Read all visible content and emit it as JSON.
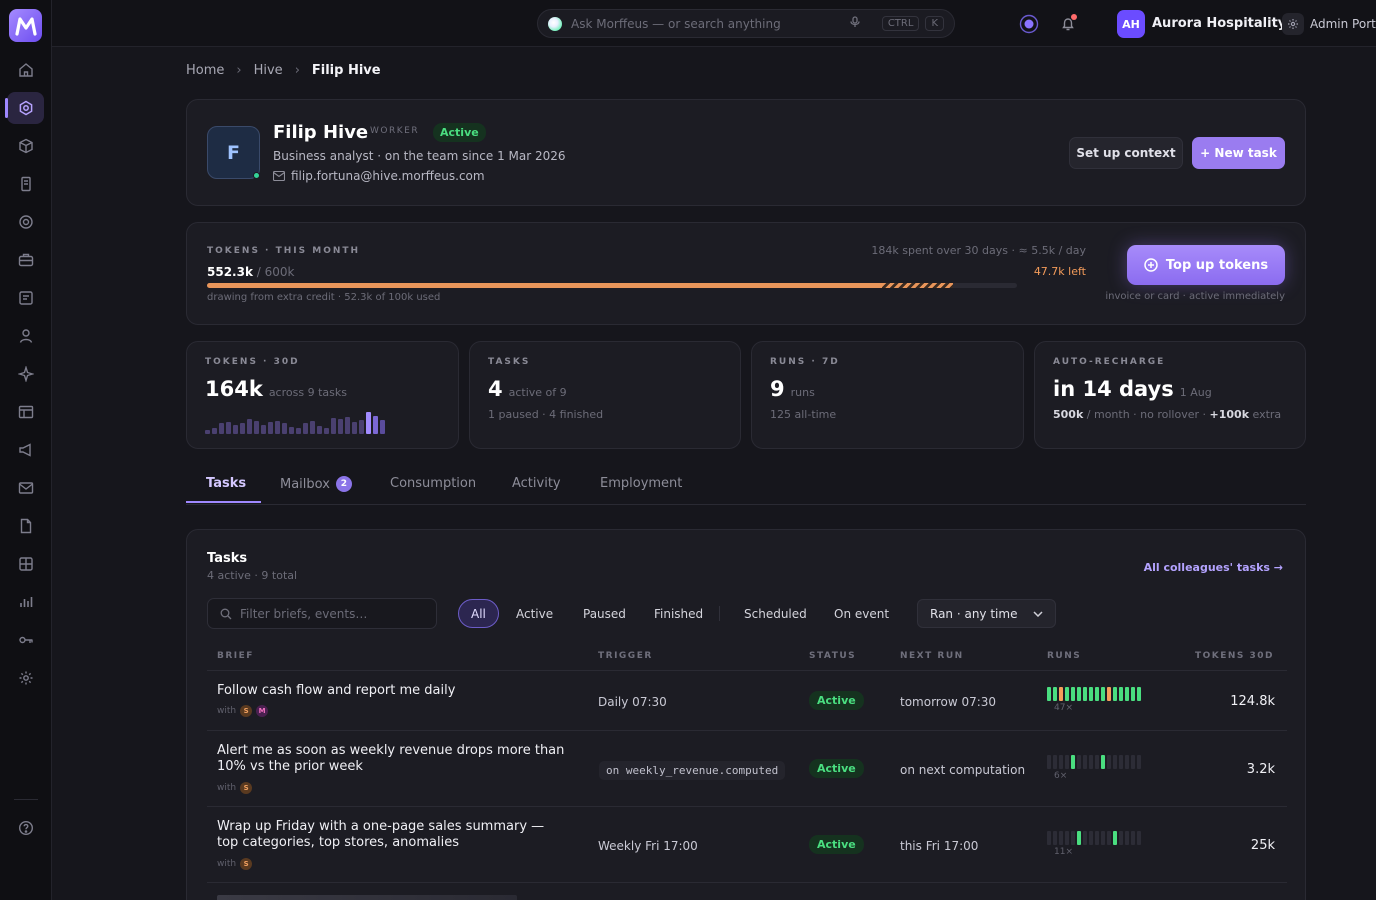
{
  "app": {
    "search_placeholder": "Ask Morffeus — or search anything",
    "kbd_ctrl": "CTRL",
    "kbd_k": "K",
    "org_initials": "AH",
    "org_name": "Aurora Hospitality",
    "portal": "Admin Portal"
  },
  "breadcrumb": [
    "Home",
    "Hive",
    "Filip Hive"
  ],
  "worker": {
    "initial": "F",
    "name": "Filip Hive",
    "role": "WORKER",
    "status": "Active",
    "subtitle": "Business analyst · on the team since 1 Mar 2026",
    "email": "filip.fortuna@hive.morffeus.com",
    "setup_label": "Set up context",
    "new_task_label": "+ New task"
  },
  "tokens": {
    "kicker": "TOKENS · THIS MONTH",
    "used": "552.3k",
    "limit": " / 600k",
    "rate": "184k spent over 30 days · ≈ 5.5k / day",
    "left": "47.7k left",
    "note": "drawing from extra credit · 52.3k of 100k used",
    "used_fraction": 0.8333,
    "extra_fraction": 0.0872,
    "topup_label": "Top up tokens",
    "topup_note": "invoice or card · active immediately"
  },
  "stats": [
    {
      "kicker": "TOKENS · 30D",
      "value": "164k",
      "unit": "across 9 tasks",
      "sub": ""
    },
    {
      "kicker": "TASKS",
      "value": "4",
      "unit": "active of 9",
      "sub": "1 paused · 4 finished"
    },
    {
      "kicker": "RUNS · 7D",
      "value": "9",
      "unit": "runs",
      "sub": "125 all-time"
    },
    {
      "kicker": "AUTO-RECHARGE",
      "value": "in 14 days",
      "unit": "1 Aug",
      "sub_a": "500k",
      "sub_b": " / month · no rollover · ",
      "sub_c": "+100k",
      "sub_d": " extra"
    }
  ],
  "tabs": [
    {
      "label": "Tasks"
    },
    {
      "label": "Mailbox",
      "count": "2"
    },
    {
      "label": "Consumption"
    },
    {
      "label": "Activity"
    },
    {
      "label": "Employment"
    }
  ],
  "tasks": {
    "title": "Tasks",
    "subtitle": "4 active · 9 total",
    "all_link": "All colleagues' tasks →",
    "filter_placeholder": "Filter briefs, events…",
    "chips": [
      "All",
      "Active",
      "Paused",
      "Finished",
      "Scheduled",
      "On event"
    ],
    "ran_select": "Ran · any time",
    "columns": [
      "BRIEF",
      "TRIGGER",
      "STATUS",
      "NEXT RUN",
      "RUNS",
      "TOKENS 30D"
    ],
    "with_label": "with",
    "rows": [
      {
        "brief": "Follow cash flow and report me daily",
        "with": [
          "S",
          "M"
        ],
        "trigger": "Daily 07:30",
        "trigger_is_event": false,
        "status": "Active",
        "next_run": "tomorrow 07:30",
        "runs_label": "47×",
        "runs": [
          "g",
          "g",
          "o",
          "g",
          "g",
          "g",
          "g",
          "g",
          "g",
          "g",
          "o",
          "g",
          "g",
          "g",
          "g",
          "g"
        ],
        "tokens": "124.8k"
      },
      {
        "brief": "Alert me as soon as weekly revenue drops more than 10% vs the prior week",
        "with": [
          "S"
        ],
        "trigger": "on weekly_revenue.computed",
        "trigger_is_event": true,
        "status": "Active",
        "next_run": "on next computation",
        "runs_label": "6×",
        "runs": [
          "n",
          "n",
          "n",
          "n",
          "g",
          "n",
          "n",
          "n",
          "n",
          "g",
          "n",
          "n",
          "n",
          "n",
          "n",
          "n"
        ],
        "tokens": "3.2k"
      },
      {
        "brief": "Wrap up Friday with a one-page sales summary — top categories, top stores, anomalies",
        "with": [
          "S"
        ],
        "trigger": "Weekly Fri 17:00",
        "trigger_is_event": false,
        "status": "Active",
        "next_run": "this Fri 17:00",
        "runs_label": "11×",
        "runs": [
          "n",
          "n",
          "n",
          "n",
          "n",
          "g",
          "n",
          "n",
          "n",
          "n",
          "n",
          "g",
          "n",
          "n",
          "n",
          "n"
        ],
        "tokens": "25k"
      }
    ]
  },
  "colors": {
    "accent": "#9f88ff",
    "active_green": "#4ade80",
    "token_orange": "#e8955a"
  }
}
